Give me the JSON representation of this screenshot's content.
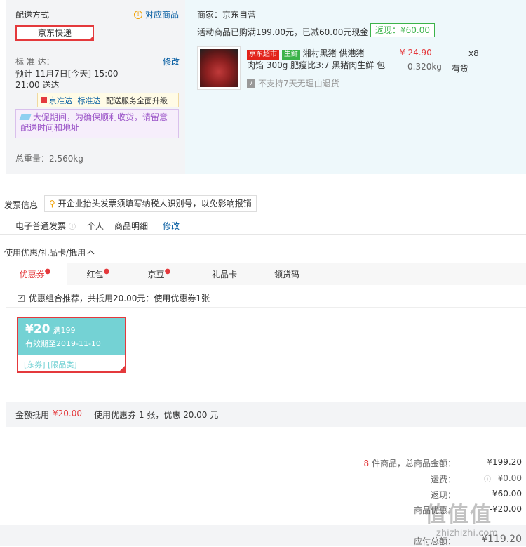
{
  "shipping": {
    "method_title": "配送方式",
    "corr_goods_link": "对应商品",
    "method_selected": "京东快递",
    "std_label": "标 准 达：",
    "modify": "修改",
    "eta_line1": "预计 11月7日[今天] 15:00-",
    "eta_line2": "21:00 送达",
    "upgrade_tag1": "京准达",
    "upgrade_tag2": "标准达",
    "upgrade_text": "配送服务全面升级",
    "promo_tip": "大促期间，为确保顺利收货，请留意配送时间和地址",
    "total_weight": "总重量：2.560kg"
  },
  "store": {
    "seller": "商家：京东自营",
    "promo": "活动商品已购满199.00元，已减60.00元现金",
    "cashback": "返现：¥60.00",
    "product": {
      "tag_market": "京东超市",
      "tag_fresh": "生鲜",
      "name_line1": "湘村黑猪 供港猪",
      "name_line2": "肉馅 300g 肥瘦比3:7 黑猪肉生鲜 包",
      "price": "¥ 24.90",
      "qty": "x8",
      "weight": "0.320kg",
      "stock": "有货",
      "no_return": "不支持7天无理由退货"
    }
  },
  "invoice": {
    "title": "发票信息",
    "tip": "开企业抬头发票须填写纳税人识别号，以免影响报销",
    "type": "电子普通发票",
    "holder": "个人",
    "content": "商品明细",
    "modify": "修改"
  },
  "discount": {
    "title": "使用优惠/礼品卡/抵用",
    "tabs": [
      "优惠券",
      "红包",
      "京豆",
      "礼品卡",
      "领货码"
    ],
    "combo": "优惠组合推荐，共抵用20.00元：使用优惠券1张",
    "coupon": {
      "amount": "¥20",
      "cond": "满199",
      "expiry": "有效期至2019-11-10",
      "tags": "[东券] [限品类]"
    },
    "summary_label": "金额抵用",
    "summary_amount": "¥20.00",
    "summary_text": "使用优惠券 1 张，优惠 20.00 元"
  },
  "totals": {
    "count": "8",
    "count_label": "件商品，总商品金额：",
    "goods_amount": "¥199.20",
    "freight_label": "运费：",
    "freight": "¥0.00",
    "cashback_label": "返现：",
    "cashback": "-¥60.00",
    "coupon_label": "商品优惠：",
    "coupon": "-¥20.00",
    "payable_label": "应付总额：",
    "payable": "¥119.20"
  },
  "watermark": "zhizhizhi.com",
  "colors": {
    "accent": "#e4393c",
    "link": "#005aa0",
    "coupon": "#74d2d4"
  }
}
